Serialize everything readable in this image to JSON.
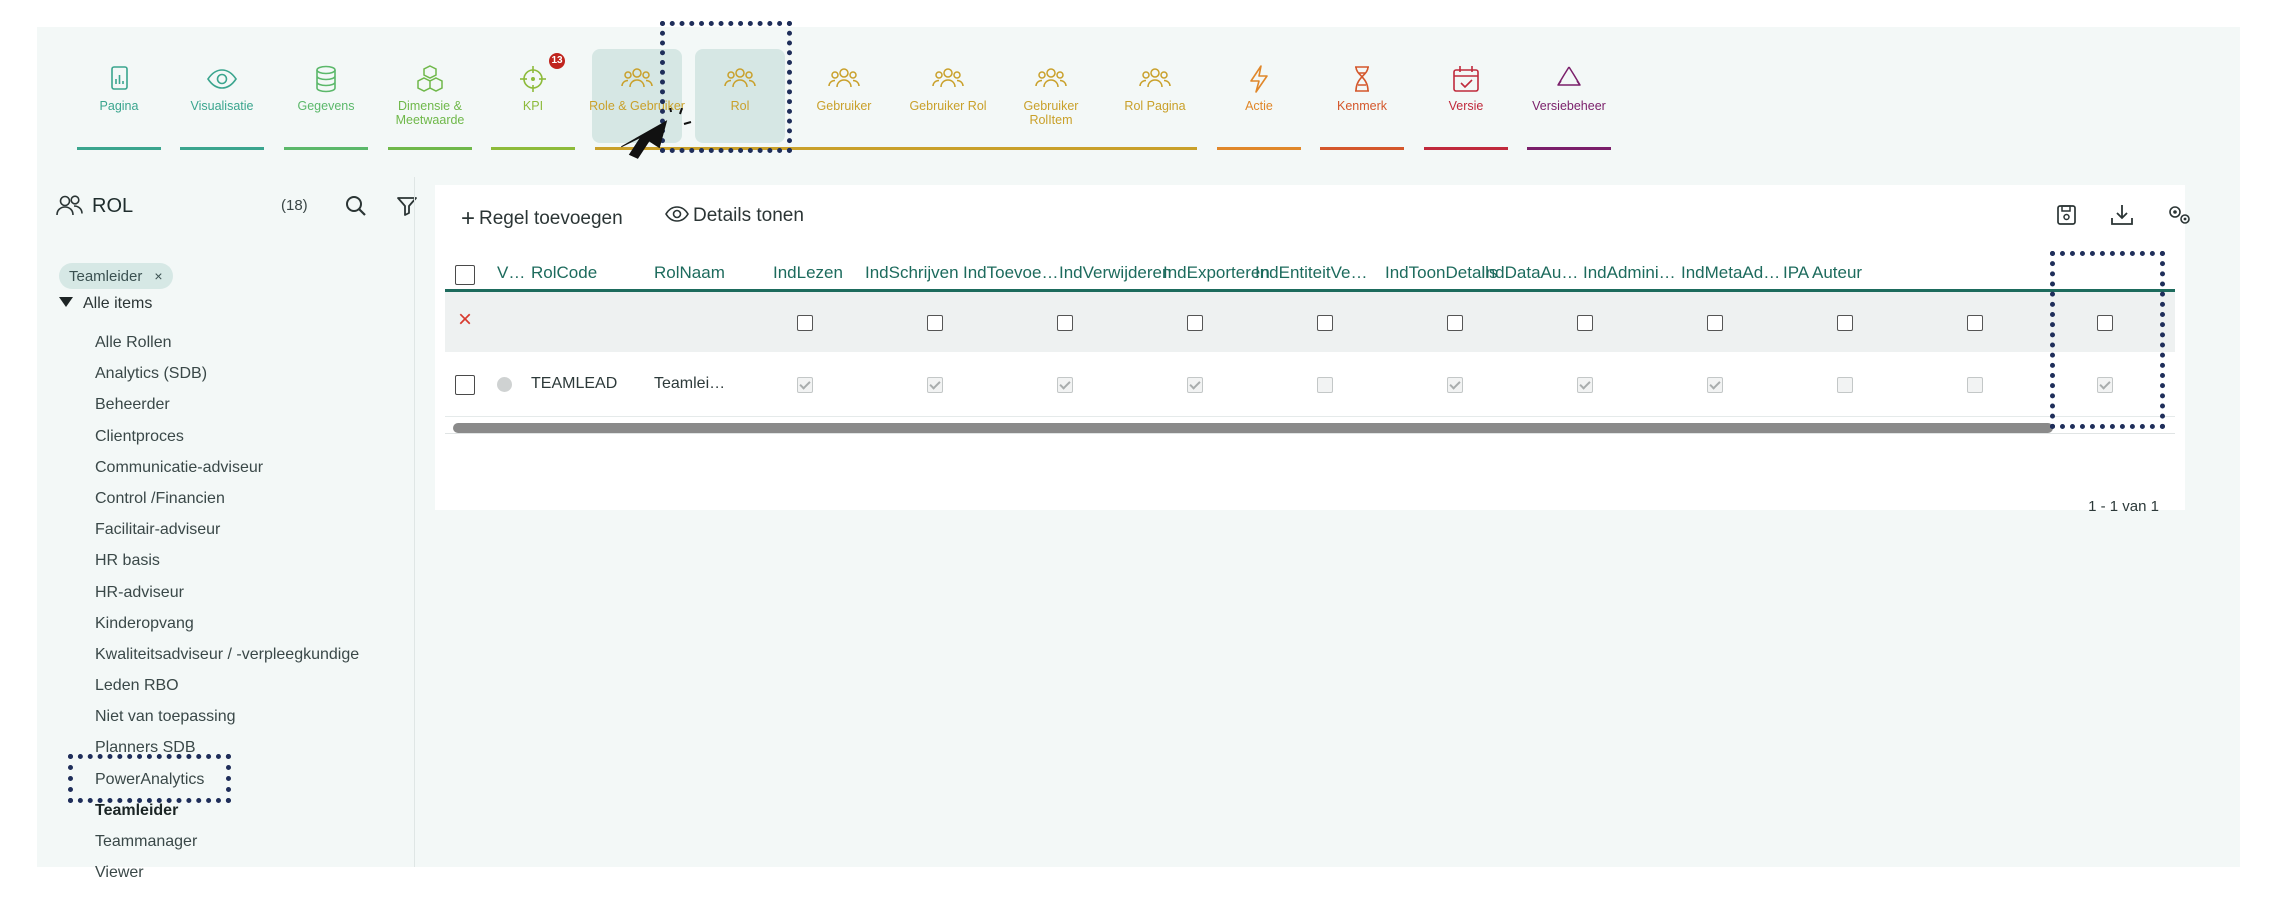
{
  "nav": {
    "items": [
      {
        "label": "Pagina",
        "icon": "file-chart-icon",
        "color": "#3aa58e"
      },
      {
        "label": "Visualisatie",
        "icon": "eye-icon",
        "color": "#3aa58e"
      },
      {
        "label": "Gegevens",
        "icon": "database-icon",
        "color": "#5bb86a"
      },
      {
        "label": "Dimensie & Meetwaarde",
        "icon": "cubes-icon",
        "color": "#6fb84a"
      },
      {
        "label": "KPI",
        "icon": "crosshair-icon",
        "color": "#8dbb3a",
        "badge": "13"
      },
      {
        "label": "Role & Gebruiker",
        "icon": "users-icon",
        "color": "#c9a02a",
        "active": true
      },
      {
        "label": "Rol",
        "icon": "users-icon",
        "color": "#c9a02a",
        "active": true
      },
      {
        "label": "Gebruiker",
        "icon": "users-icon",
        "color": "#c9a02a"
      },
      {
        "label": "Gebruiker Rol",
        "icon": "users-icon",
        "color": "#c9a02a"
      },
      {
        "label": "Gebruiker RolItem",
        "icon": "users-icon",
        "color": "#c9a02a"
      },
      {
        "label": "Rol Pagina",
        "icon": "users-icon",
        "color": "#c9a02a"
      },
      {
        "label": "Actie",
        "icon": "bolt-icon",
        "color": "#e0872a"
      },
      {
        "label": "Kenmerk",
        "icon": "dna-icon",
        "color": "#d4572b"
      },
      {
        "label": "Versie",
        "icon": "calendar-check-icon",
        "color": "#c02a3c"
      },
      {
        "label": "Versiebeheer",
        "icon": "recycle-icon",
        "color": "#7a1f6a"
      }
    ]
  },
  "sidebar": {
    "title": "ROL",
    "count": "(18)",
    "filter_chip": "Teamleider",
    "chip_close": "×",
    "root": "Alle items",
    "items": [
      "Alle Rollen",
      "Analytics (SDB)",
      "Beheerder",
      "Clientproces",
      "Communicatie-adviseur",
      "Control /Financien",
      "Facilitair-adviseur",
      "HR basis",
      "HR-adviseur",
      "Kinderopvang",
      "Kwaliteitsadviseur / -verpleegkundige",
      "Leden RBO",
      "Niet van toepassing",
      "Planners SDB",
      "PowerAnalytics",
      "Teamleider",
      "Teammanager",
      "Viewer"
    ],
    "active_item": "Teamleider"
  },
  "toolbar": {
    "add_row": "Regel toevoegen",
    "show_details": "Details tonen",
    "add_icon": "+"
  },
  "grid": {
    "columns": [
      "V…",
      "RolCode",
      "RolNaam",
      "IndLezen",
      "IndSchrijven",
      "IndToevoegen",
      "IndVerwijderen",
      "IndExporteren",
      "IndEntiteitVe…",
      "IndToonDetails",
      "IndDataAutor…",
      "IndAdministr…",
      "IndMetaAdmi…",
      "IPA Auteur"
    ],
    "filter_clear": "×",
    "rows": [
      {
        "rolcode": "TEAMLEAD",
        "rolnaam": "Teamlei…",
        "flags": [
          true,
          true,
          true,
          true,
          false,
          true,
          true,
          true,
          false,
          false,
          true
        ]
      }
    ]
  },
  "pager": {
    "text": "1 - 1 van  1"
  }
}
